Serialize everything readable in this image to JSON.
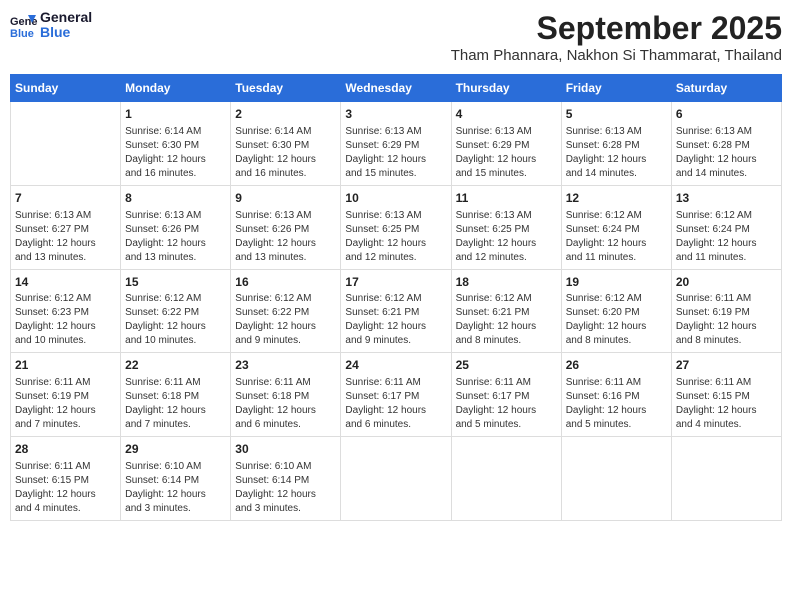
{
  "header": {
    "logo_general": "General",
    "logo_blue": "Blue",
    "title": "September 2025",
    "subtitle": "Tham Phannara, Nakhon Si Thammarat, Thailand"
  },
  "days_of_week": [
    "Sunday",
    "Monday",
    "Tuesday",
    "Wednesday",
    "Thursday",
    "Friday",
    "Saturday"
  ],
  "weeks": [
    [
      {
        "day": "",
        "info": ""
      },
      {
        "day": "1",
        "info": "Sunrise: 6:14 AM\nSunset: 6:30 PM\nDaylight: 12 hours\nand 16 minutes."
      },
      {
        "day": "2",
        "info": "Sunrise: 6:14 AM\nSunset: 6:30 PM\nDaylight: 12 hours\nand 16 minutes."
      },
      {
        "day": "3",
        "info": "Sunrise: 6:13 AM\nSunset: 6:29 PM\nDaylight: 12 hours\nand 15 minutes."
      },
      {
        "day": "4",
        "info": "Sunrise: 6:13 AM\nSunset: 6:29 PM\nDaylight: 12 hours\nand 15 minutes."
      },
      {
        "day": "5",
        "info": "Sunrise: 6:13 AM\nSunset: 6:28 PM\nDaylight: 12 hours\nand 14 minutes."
      },
      {
        "day": "6",
        "info": "Sunrise: 6:13 AM\nSunset: 6:28 PM\nDaylight: 12 hours\nand 14 minutes."
      }
    ],
    [
      {
        "day": "7",
        "info": "Sunrise: 6:13 AM\nSunset: 6:27 PM\nDaylight: 12 hours\nand 13 minutes."
      },
      {
        "day": "8",
        "info": "Sunrise: 6:13 AM\nSunset: 6:26 PM\nDaylight: 12 hours\nand 13 minutes."
      },
      {
        "day": "9",
        "info": "Sunrise: 6:13 AM\nSunset: 6:26 PM\nDaylight: 12 hours\nand 13 minutes."
      },
      {
        "day": "10",
        "info": "Sunrise: 6:13 AM\nSunset: 6:25 PM\nDaylight: 12 hours\nand 12 minutes."
      },
      {
        "day": "11",
        "info": "Sunrise: 6:13 AM\nSunset: 6:25 PM\nDaylight: 12 hours\nand 12 minutes."
      },
      {
        "day": "12",
        "info": "Sunrise: 6:12 AM\nSunset: 6:24 PM\nDaylight: 12 hours\nand 11 minutes."
      },
      {
        "day": "13",
        "info": "Sunrise: 6:12 AM\nSunset: 6:24 PM\nDaylight: 12 hours\nand 11 minutes."
      }
    ],
    [
      {
        "day": "14",
        "info": "Sunrise: 6:12 AM\nSunset: 6:23 PM\nDaylight: 12 hours\nand 10 minutes."
      },
      {
        "day": "15",
        "info": "Sunrise: 6:12 AM\nSunset: 6:22 PM\nDaylight: 12 hours\nand 10 minutes."
      },
      {
        "day": "16",
        "info": "Sunrise: 6:12 AM\nSunset: 6:22 PM\nDaylight: 12 hours\nand 9 minutes."
      },
      {
        "day": "17",
        "info": "Sunrise: 6:12 AM\nSunset: 6:21 PM\nDaylight: 12 hours\nand 9 minutes."
      },
      {
        "day": "18",
        "info": "Sunrise: 6:12 AM\nSunset: 6:21 PM\nDaylight: 12 hours\nand 8 minutes."
      },
      {
        "day": "19",
        "info": "Sunrise: 6:12 AM\nSunset: 6:20 PM\nDaylight: 12 hours\nand 8 minutes."
      },
      {
        "day": "20",
        "info": "Sunrise: 6:11 AM\nSunset: 6:19 PM\nDaylight: 12 hours\nand 8 minutes."
      }
    ],
    [
      {
        "day": "21",
        "info": "Sunrise: 6:11 AM\nSunset: 6:19 PM\nDaylight: 12 hours\nand 7 minutes."
      },
      {
        "day": "22",
        "info": "Sunrise: 6:11 AM\nSunset: 6:18 PM\nDaylight: 12 hours\nand 7 minutes."
      },
      {
        "day": "23",
        "info": "Sunrise: 6:11 AM\nSunset: 6:18 PM\nDaylight: 12 hours\nand 6 minutes."
      },
      {
        "day": "24",
        "info": "Sunrise: 6:11 AM\nSunset: 6:17 PM\nDaylight: 12 hours\nand 6 minutes."
      },
      {
        "day": "25",
        "info": "Sunrise: 6:11 AM\nSunset: 6:17 PM\nDaylight: 12 hours\nand 5 minutes."
      },
      {
        "day": "26",
        "info": "Sunrise: 6:11 AM\nSunset: 6:16 PM\nDaylight: 12 hours\nand 5 minutes."
      },
      {
        "day": "27",
        "info": "Sunrise: 6:11 AM\nSunset: 6:15 PM\nDaylight: 12 hours\nand 4 minutes."
      }
    ],
    [
      {
        "day": "28",
        "info": "Sunrise: 6:11 AM\nSunset: 6:15 PM\nDaylight: 12 hours\nand 4 minutes."
      },
      {
        "day": "29",
        "info": "Sunrise: 6:10 AM\nSunset: 6:14 PM\nDaylight: 12 hours\nand 3 minutes."
      },
      {
        "day": "30",
        "info": "Sunrise: 6:10 AM\nSunset: 6:14 PM\nDaylight: 12 hours\nand 3 minutes."
      },
      {
        "day": "",
        "info": ""
      },
      {
        "day": "",
        "info": ""
      },
      {
        "day": "",
        "info": ""
      },
      {
        "day": "",
        "info": ""
      }
    ]
  ]
}
